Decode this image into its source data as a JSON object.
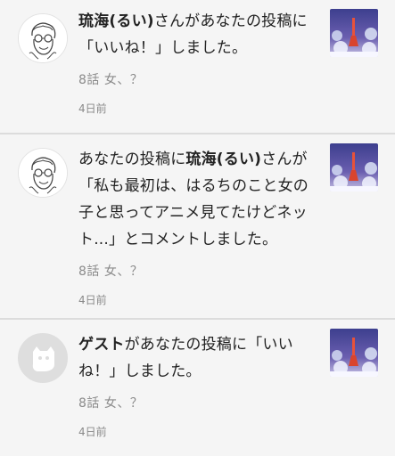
{
  "notifications": [
    {
      "actor": "琉海(るい)",
      "text_before": "",
      "text_after": "さんがあなたの投稿に「いいね！」しました。",
      "post_title": "8話 女、？",
      "time": "4日前",
      "avatar_icon": "user-sketch-avatar-icon",
      "thumbnail_icon": "illuminated-tower-thumbnail"
    },
    {
      "actor": "琉海(るい)",
      "text_before": "あなたの投稿に",
      "text_after": "さんが「私も最初は、はるちのこと女の子と思ってアニメ見てたけどネット...」とコメントしました。",
      "post_title": "8話 女、？",
      "time": "4日前",
      "avatar_icon": "user-sketch-avatar-icon",
      "thumbnail_icon": "illuminated-tower-thumbnail"
    },
    {
      "actor": "ゲスト",
      "text_before": "",
      "text_after": "があなたの投稿に「いいね！」しました。",
      "post_title": "8話 女、？",
      "time": "4日前",
      "avatar_icon": "guest-avatar-icon",
      "thumbnail_icon": "illuminated-tower-thumbnail"
    }
  ],
  "colors": {
    "background": "#f5f5f5",
    "divider": "#dcdcdc",
    "meta_text": "#8a8a8a",
    "thumbnail_sky": "#4b4f9a"
  }
}
